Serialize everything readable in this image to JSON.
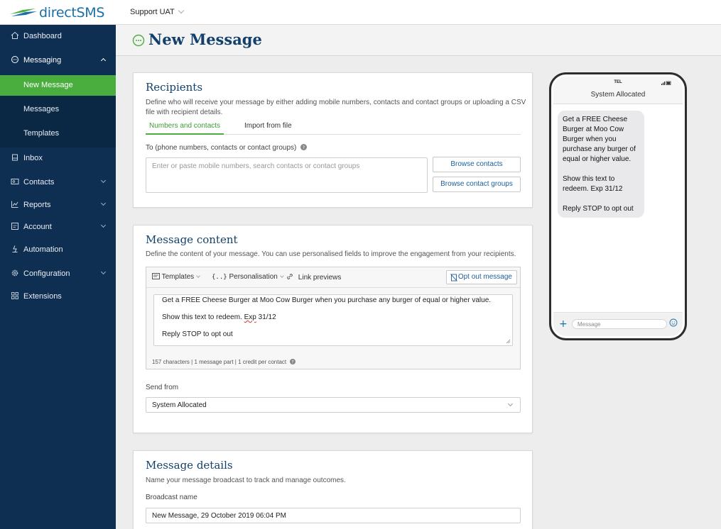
{
  "brand": {
    "name": "directSMS"
  },
  "topbar": {
    "account": "Support UAT"
  },
  "sidebar": {
    "items": [
      {
        "label": "Dashboard",
        "icon": "home-icon"
      },
      {
        "label": "Messaging",
        "icon": "chat-bubble-icon"
      },
      {
        "label": "Inbox",
        "icon": "inbox-icon"
      },
      {
        "label": "Contacts",
        "icon": "contacts-card-icon"
      },
      {
        "label": "Reports",
        "icon": "line-chart-icon"
      },
      {
        "label": "Account",
        "icon": "account-icon"
      },
      {
        "label": "Automation",
        "icon": "automation-icon"
      },
      {
        "label": "Configuration",
        "icon": "gear-icon"
      },
      {
        "label": "Extensions",
        "icon": "grid-icon"
      }
    ],
    "messaging_sub": [
      {
        "label": "New Message",
        "active": true
      },
      {
        "label": "Messages",
        "active": false
      },
      {
        "label": "Templates",
        "active": false
      }
    ]
  },
  "page": {
    "title": "New Message"
  },
  "recipients": {
    "title": "Recipients",
    "description_line1": "Define who will receive your message by either adding mobile numbers, contacts and contact groups or uploading a CSV",
    "description_line2": "file with recipient details.",
    "tabs": [
      {
        "label": "Numbers and contacts"
      },
      {
        "label": "Import from file"
      }
    ],
    "to_label": "To (phone numbers, contacts or contact groups)",
    "to_placeholder": "Enter or paste mobile numbers, search contacts or contact groups",
    "browse_contacts": "Browse contacts",
    "browse_groups": "Browse contact groups"
  },
  "content": {
    "title": "Message content",
    "description": "Define the content of your message. You can use personalised fields to improve the engagement from your recipients.",
    "toolbar": {
      "templates": "Templates",
      "personalisation": "Personalisation",
      "link_previews": "Link previews",
      "opt_out": "Opt out message"
    },
    "message_lines": {
      "line1": "Get a FREE Cheese Burger at Moo Cow Burger when you purchase any burger of equal or higher value.",
      "line2_prefix": "Show this text to redeem. ",
      "line2_sq": "Exp",
      "line2_suffix": " 31/12",
      "line3": "Reply STOP to opt out"
    },
    "char_info": "157 characters | 1 message part | 1 credit per contact",
    "send_from_label": "Send from",
    "send_from_value": "System Allocated"
  },
  "details": {
    "title": "Message details",
    "description": "Name your message broadcast to track and manage outcomes.",
    "broadcast_label": "Broadcast name",
    "broadcast_value": "New Message, 29 October 2019 06:04 PM"
  },
  "preview": {
    "carrier": "TEL",
    "sender": "System Allocated",
    "bubble_lines_a": [
      "Get a FREE Cheese",
      "Burger at Moo Cow",
      "Burger when you",
      "purchase any burger of",
      "equal or higher value."
    ],
    "bubble_lines_b": [
      "Show this text to",
      "redeem. Exp 31/12"
    ],
    "bubble_line_c": "Reply STOP to opt out",
    "input_placeholder": "Message"
  },
  "colors": {
    "sidebar": "#0e2f52",
    "active": "#4aae3f",
    "title": "#12406b",
    "link": "#1b5f99"
  }
}
